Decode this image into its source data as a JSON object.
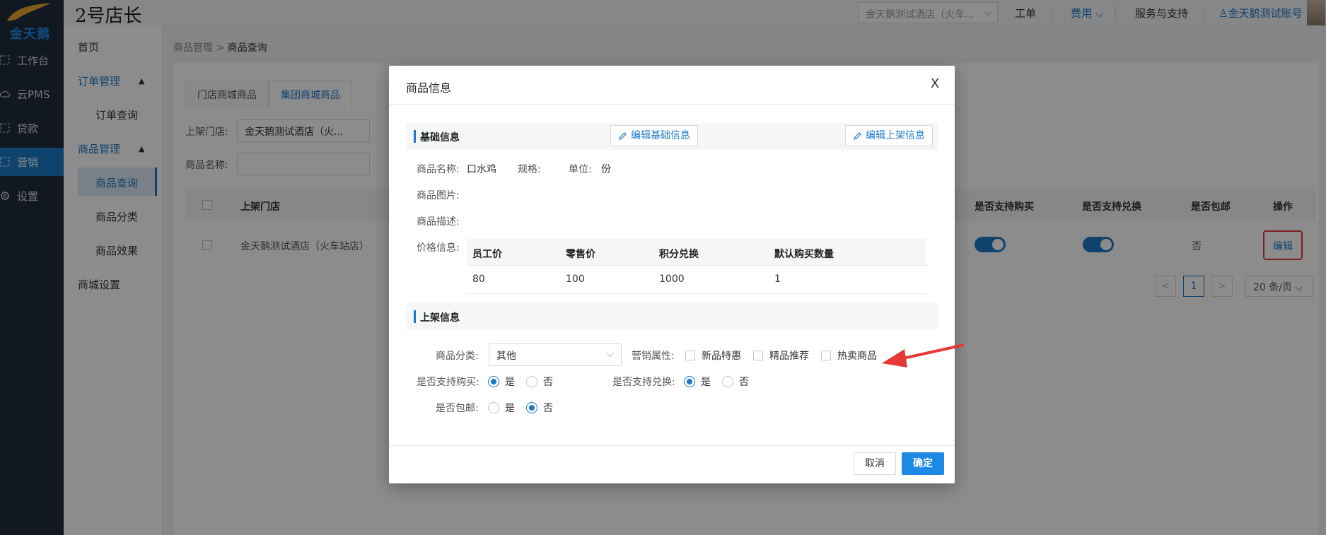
{
  "brand": {
    "logo_text": "金天鹅",
    "app_name": "2号店长"
  },
  "rail": {
    "items": [
      {
        "label": "工作台",
        "icon": "dashboard-icon"
      },
      {
        "label": "云PMS",
        "icon": "cloud-icon"
      },
      {
        "label": "贷款",
        "icon": "loan-icon"
      },
      {
        "label": "营销",
        "icon": "marketing-icon"
      },
      {
        "label": "设置",
        "icon": "gear-icon"
      }
    ]
  },
  "submenu": {
    "home": "首页",
    "order_group": "订单管理",
    "order_query": "订单查询",
    "goods_group": "商品管理",
    "goods_query": "商品查询",
    "goods_category": "商品分类",
    "goods_effect": "商品效果",
    "mall_settings": "商城设置"
  },
  "header": {
    "hotel_select": "金天鹅测试酒店（火车...",
    "work_order": "工单",
    "fee": "费用",
    "service": "服务与支持",
    "account": "金天鹅测试账号"
  },
  "breadcrumb": {
    "parent": "商品管理",
    "sep": " > ",
    "current": "商品查询"
  },
  "tabs": [
    "门店商城商品",
    "集团商城商品"
  ],
  "filters": {
    "store_label": "上架门店:",
    "store_value": "金天鹅测试酒店（火...",
    "name_label": "商品名称:"
  },
  "grid": {
    "headers": {
      "store": "上架门店",
      "buy": "是否支持购买",
      "exchange": "是否支持兑换",
      "shipping": "是否包邮",
      "action": "操作"
    },
    "row": {
      "store": "金天鹅测试酒店（火车站店）",
      "shipping": "否",
      "action": "编辑"
    }
  },
  "pager": {
    "prev": "<",
    "current": "1",
    "next": ">",
    "page_size": "20 条/页"
  },
  "modal": {
    "title": "商品信息",
    "close": "X",
    "basic_section": "基础信息",
    "edit_basic": "编辑基础信息",
    "edit_listing": "编辑上架信息",
    "name_label": "商品名称:",
    "name_value": "口水鸡",
    "spec_label": "规格:",
    "spec_value": "",
    "unit_label": "单位:",
    "unit_value": "份",
    "image_label": "商品图片:",
    "desc_label": "商品描述:",
    "price_label": "价格信息:",
    "price_table": {
      "headers": [
        "员工价",
        "零售价",
        "积分兑换",
        "默认购买数量"
      ],
      "rows": [
        [
          "80",
          "100",
          "1000",
          "1"
        ]
      ]
    },
    "listing_section": "上架信息",
    "category_label": "商品分类:",
    "category_value": "其他",
    "marketing_label": "营销属性:",
    "marketing_options": [
      "新品特惠",
      "精品推荐",
      "热卖商品"
    ],
    "buy_label": "是否支持购买:",
    "exchange_label": "是否支持兑换:",
    "shipping_label": "是否包邮:",
    "yes": "是",
    "no": "否",
    "cancel": "取消",
    "ok": "确定"
  },
  "colors": {
    "accent": "#1e78c8",
    "primary_button": "#1e88e5",
    "annotation": "#e53935"
  }
}
